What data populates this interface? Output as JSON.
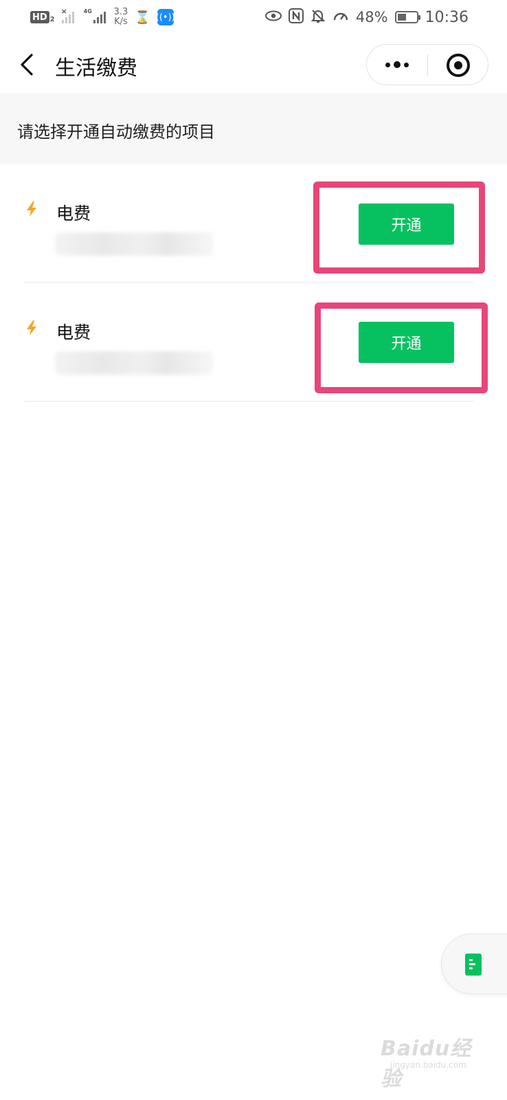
{
  "status_bar": {
    "hd_label": "HD",
    "hd_sub": "2",
    "network_tag": "4G",
    "net_speed_value": "3.3",
    "net_speed_unit": "K/s",
    "battery_percent": "48%",
    "battery_level": 0.48,
    "time": "10:36",
    "icons": [
      "hd-icon",
      "no-signal-icon",
      "signal-icon",
      "hourglass-icon",
      "wifi-app-icon",
      "eye-icon",
      "nfc-icon",
      "mute-bell-icon",
      "speedometer-icon",
      "battery-icon"
    ]
  },
  "nav": {
    "title": "生活缴费",
    "back_icon": "chevron-left-icon",
    "more_icon": "more-dots-icon",
    "close_icon": "target-close-icon"
  },
  "hint": {
    "text": "请选择开通自动缴费的项目"
  },
  "items": [
    {
      "name": "电费",
      "icon": "lightning-icon",
      "button_label": "开通"
    },
    {
      "name": "电费",
      "icon": "lightning-icon",
      "button_label": "开通"
    }
  ],
  "float_button": {
    "icon": "bill-list-icon"
  },
  "colors": {
    "accent_green": "#07c160",
    "highlight_pink": "#e84579",
    "lightning_orange": "#f5a623",
    "hint_bg": "#f7f7f7"
  },
  "watermark": {
    "logo": "Baidu经验",
    "site": "jingyan.baidu.com"
  }
}
